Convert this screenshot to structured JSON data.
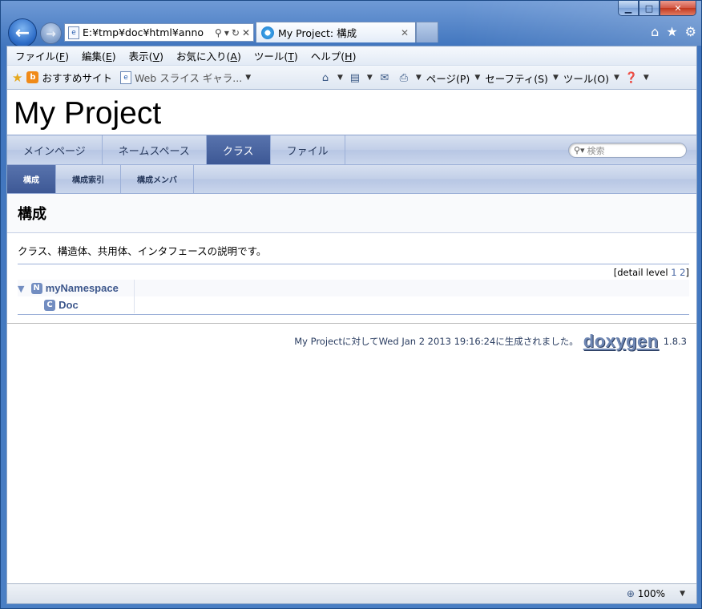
{
  "window": {
    "caption_buttons": {
      "minimize": "▁",
      "maximize": "□",
      "close": "✕"
    }
  },
  "browser": {
    "back_icon": "back-arrow-icon",
    "forward_icon": "forward-arrow-icon",
    "address": "E:¥tmp¥doc¥html¥anno",
    "tab_title": "My Project: 構成",
    "tab_close": "✕",
    "right_icons": [
      "home-icon",
      "favorites-star-icon",
      "tools-gear-icon"
    ],
    "menu": [
      {
        "label": "ファイル(",
        "key": "F",
        "end": ")"
      },
      {
        "label": "編集(",
        "key": "E",
        "end": ")"
      },
      {
        "label": "表示(",
        "key": "V",
        "end": ")"
      },
      {
        "label": "お気に入り(",
        "key": "A",
        "end": ")"
      },
      {
        "label": "ツール(",
        "key": "T",
        "end": ")"
      },
      {
        "label": "ヘルプ(",
        "key": "H",
        "end": ")"
      }
    ],
    "favorites": {
      "item1": "おすすめサイト",
      "item2": "Web スライス ギャラ..."
    },
    "commands": {
      "page": "ページ(P)",
      "safety": "セーフティ(S)",
      "tools": "ツール(O)"
    },
    "status": {
      "zoom": "100%"
    }
  },
  "doc": {
    "project_title": "My Project",
    "nav_tabs": [
      "メインページ",
      "ネームスペース",
      "クラス",
      "ファイル"
    ],
    "active_tab_index": 2,
    "search_placeholder": "検索",
    "sub_tabs": [
      "構成",
      "構成索引",
      "構成メンバ"
    ],
    "active_sub_index": 0,
    "heading": "構成",
    "description": "クラス、構造体、共用体、インタフェースの説明です。",
    "detail_level": {
      "prefix": "[detail level",
      "l1": "1",
      "l2": "2",
      "suffix": "]"
    },
    "entries": [
      {
        "badge": "N",
        "name": "myNamespace"
      },
      {
        "badge": "C",
        "name": "Doc"
      }
    ],
    "footer": {
      "text": "My Projectに対してWed Jan 2 2013 19:16:24に生成されました。",
      "logo": "doxygen",
      "version": "1.8.3"
    }
  }
}
